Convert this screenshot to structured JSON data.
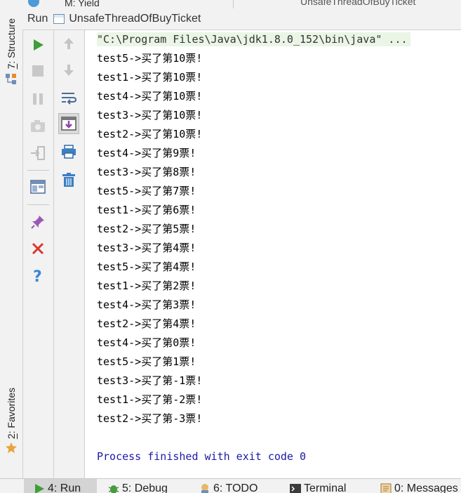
{
  "top_tabs": [
    {
      "label": "M: Yield"
    },
    {
      "label": "UnsafeThreadOfBuyTicket"
    }
  ],
  "side_tabs": {
    "structure": {
      "number": "7",
      "label": ": Structure"
    },
    "favorites": {
      "number": "2",
      "label": ": Favorites"
    }
  },
  "run_header": {
    "label": "Run",
    "config_name": "UnsafeThreadOfBuyTicket"
  },
  "toolbar_left": [
    {
      "icon": "run-icon",
      "color": "#3f9e37"
    },
    {
      "icon": "stop-icon"
    },
    {
      "icon": "pause-icon"
    },
    {
      "icon": "camera-icon"
    },
    {
      "icon": "exit-icon"
    },
    {
      "icon": "layout-icon"
    },
    {
      "icon": "pin-icon",
      "color": "#9b59b6"
    },
    {
      "icon": "close-icon",
      "color": "#d9362b"
    },
    {
      "icon": "help-icon",
      "color": "#3b86d6"
    }
  ],
  "toolbar_right": [
    {
      "icon": "up-arrow-icon"
    },
    {
      "icon": "down-arrow-icon"
    },
    {
      "icon": "soft-wrap-icon"
    },
    {
      "icon": "scroll-to-end-icon"
    },
    {
      "icon": "print-icon"
    },
    {
      "icon": "trash-icon"
    }
  ],
  "console": {
    "command": "\"C:\\Program Files\\Java\\jdk1.8.0_152\\bin\\java\" ...",
    "lines": [
      "test5->买了第10票!",
      "test1->买了第10票!",
      "test4->买了第10票!",
      "test3->买了第10票!",
      "test2->买了第10票!",
      "test4->买了第9票!",
      "test3->买了第8票!",
      "test5->买了第7票!",
      "test1->买了第6票!",
      "test2->买了第5票!",
      "test3->买了第4票!",
      "test5->买了第4票!",
      "test1->买了第2票!",
      "test4->买了第3票!",
      "test2->买了第4票!",
      "test4->买了第0票!",
      "test5->买了第1票!",
      "test3->买了第-1票!",
      "test1->买了第-2票!",
      "test2->买了第-3票!"
    ],
    "exit_message": "Process finished with exit code 0"
  },
  "bottom_tabs": [
    {
      "label": "4: Run",
      "icon": "run-icon",
      "active": true
    },
    {
      "label": "5: Debug",
      "icon": "bug-icon"
    },
    {
      "label": "6: TODO",
      "icon": "todo-icon"
    },
    {
      "label": "Terminal",
      "icon": "terminal-icon"
    },
    {
      "label": "0: Messages",
      "icon": "messages-icon"
    }
  ]
}
